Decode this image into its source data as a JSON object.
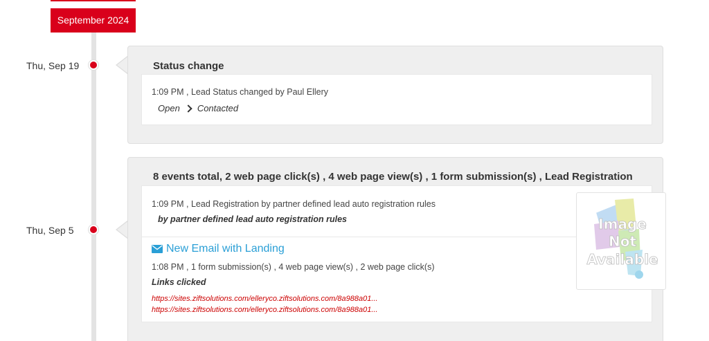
{
  "timeline": {
    "month_label": "September 2024",
    "colors": {
      "accent": "#d9001b",
      "link": "#2a9fd6",
      "url": "#cc0000"
    }
  },
  "events": [
    {
      "date": "Thu, Sep 19",
      "title": "Status change",
      "time_line": "1:09 PM , Lead Status changed by Paul Ellery",
      "status_from": "Open",
      "status_to": "Contacted"
    },
    {
      "date": "Thu, Sep 5",
      "title": "8 events total, 2 web page click(s) , 4 web page view(s) , 1 form submission(s) , Lead Registration",
      "registration": {
        "time_line": "1:09 PM , Lead Registration by partner defined lead auto registration rules",
        "detail": "by partner defined lead auto registration rules"
      },
      "email": {
        "icon": "envelope-icon",
        "link_label": "New Email with Landing",
        "time_line": "1:08 PM , 1 form submission(s) , 4 web page view(s) , 2 web page click(s)",
        "links_heading": "Links clicked",
        "urls": [
          "https://sites.ziftsolutions.com/elleryco.ziftsolutions.com/8a988a01...",
          "https://sites.ziftsolutions.com/elleryco.ziftsolutions.com/8a988a01..."
        ]
      },
      "thumbnail": {
        "line1": "Image",
        "line2": "Not",
        "line3": "Available"
      }
    }
  ]
}
